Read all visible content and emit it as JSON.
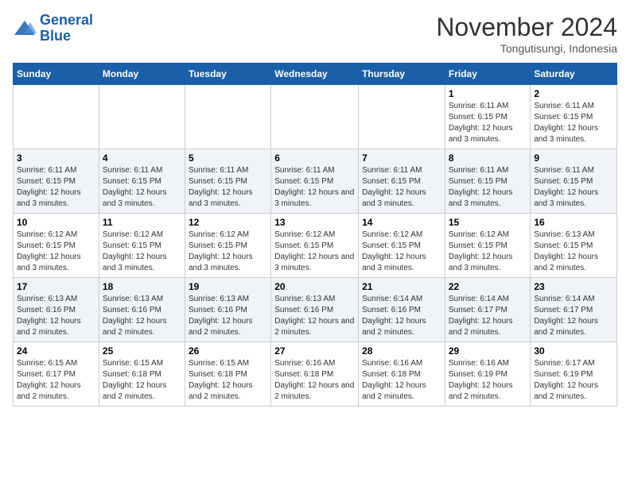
{
  "logo": {
    "line1": "General",
    "line2": "Blue"
  },
  "header": {
    "month": "November 2024",
    "location": "Tongutisungi, Indonesia"
  },
  "days_of_week": [
    "Sunday",
    "Monday",
    "Tuesday",
    "Wednesday",
    "Thursday",
    "Friday",
    "Saturday"
  ],
  "weeks": [
    [
      {
        "day": "",
        "info": ""
      },
      {
        "day": "",
        "info": ""
      },
      {
        "day": "",
        "info": ""
      },
      {
        "day": "",
        "info": ""
      },
      {
        "day": "",
        "info": ""
      },
      {
        "day": "1",
        "info": "Sunrise: 6:11 AM\nSunset: 6:15 PM\nDaylight: 12 hours and 3 minutes."
      },
      {
        "day": "2",
        "info": "Sunrise: 6:11 AM\nSunset: 6:15 PM\nDaylight: 12 hours and 3 minutes."
      }
    ],
    [
      {
        "day": "3",
        "info": "Sunrise: 6:11 AM\nSunset: 6:15 PM\nDaylight: 12 hours and 3 minutes."
      },
      {
        "day": "4",
        "info": "Sunrise: 6:11 AM\nSunset: 6:15 PM\nDaylight: 12 hours and 3 minutes."
      },
      {
        "day": "5",
        "info": "Sunrise: 6:11 AM\nSunset: 6:15 PM\nDaylight: 12 hours and 3 minutes."
      },
      {
        "day": "6",
        "info": "Sunrise: 6:11 AM\nSunset: 6:15 PM\nDaylight: 12 hours and 3 minutes."
      },
      {
        "day": "7",
        "info": "Sunrise: 6:11 AM\nSunset: 6:15 PM\nDaylight: 12 hours and 3 minutes."
      },
      {
        "day": "8",
        "info": "Sunrise: 6:11 AM\nSunset: 6:15 PM\nDaylight: 12 hours and 3 minutes."
      },
      {
        "day": "9",
        "info": "Sunrise: 6:11 AM\nSunset: 6:15 PM\nDaylight: 12 hours and 3 minutes."
      }
    ],
    [
      {
        "day": "10",
        "info": "Sunrise: 6:12 AM\nSunset: 6:15 PM\nDaylight: 12 hours and 3 minutes."
      },
      {
        "day": "11",
        "info": "Sunrise: 6:12 AM\nSunset: 6:15 PM\nDaylight: 12 hours and 3 minutes."
      },
      {
        "day": "12",
        "info": "Sunrise: 6:12 AM\nSunset: 6:15 PM\nDaylight: 12 hours and 3 minutes."
      },
      {
        "day": "13",
        "info": "Sunrise: 6:12 AM\nSunset: 6:15 PM\nDaylight: 12 hours and 3 minutes."
      },
      {
        "day": "14",
        "info": "Sunrise: 6:12 AM\nSunset: 6:15 PM\nDaylight: 12 hours and 3 minutes."
      },
      {
        "day": "15",
        "info": "Sunrise: 6:12 AM\nSunset: 6:15 PM\nDaylight: 12 hours and 3 minutes."
      },
      {
        "day": "16",
        "info": "Sunrise: 6:13 AM\nSunset: 6:15 PM\nDaylight: 12 hours and 2 minutes."
      }
    ],
    [
      {
        "day": "17",
        "info": "Sunrise: 6:13 AM\nSunset: 6:16 PM\nDaylight: 12 hours and 2 minutes."
      },
      {
        "day": "18",
        "info": "Sunrise: 6:13 AM\nSunset: 6:16 PM\nDaylight: 12 hours and 2 minutes."
      },
      {
        "day": "19",
        "info": "Sunrise: 6:13 AM\nSunset: 6:16 PM\nDaylight: 12 hours and 2 minutes."
      },
      {
        "day": "20",
        "info": "Sunrise: 6:13 AM\nSunset: 6:16 PM\nDaylight: 12 hours and 2 minutes."
      },
      {
        "day": "21",
        "info": "Sunrise: 6:14 AM\nSunset: 6:16 PM\nDaylight: 12 hours and 2 minutes."
      },
      {
        "day": "22",
        "info": "Sunrise: 6:14 AM\nSunset: 6:17 PM\nDaylight: 12 hours and 2 minutes."
      },
      {
        "day": "23",
        "info": "Sunrise: 6:14 AM\nSunset: 6:17 PM\nDaylight: 12 hours and 2 minutes."
      }
    ],
    [
      {
        "day": "24",
        "info": "Sunrise: 6:15 AM\nSunset: 6:17 PM\nDaylight: 12 hours and 2 minutes."
      },
      {
        "day": "25",
        "info": "Sunrise: 6:15 AM\nSunset: 6:18 PM\nDaylight: 12 hours and 2 minutes."
      },
      {
        "day": "26",
        "info": "Sunrise: 6:15 AM\nSunset: 6:18 PM\nDaylight: 12 hours and 2 minutes."
      },
      {
        "day": "27",
        "info": "Sunrise: 6:16 AM\nSunset: 6:18 PM\nDaylight: 12 hours and 2 minutes."
      },
      {
        "day": "28",
        "info": "Sunrise: 6:16 AM\nSunset: 6:18 PM\nDaylight: 12 hours and 2 minutes."
      },
      {
        "day": "29",
        "info": "Sunrise: 6:16 AM\nSunset: 6:19 PM\nDaylight: 12 hours and 2 minutes."
      },
      {
        "day": "30",
        "info": "Sunrise: 6:17 AM\nSunset: 6:19 PM\nDaylight: 12 hours and 2 minutes."
      }
    ]
  ]
}
